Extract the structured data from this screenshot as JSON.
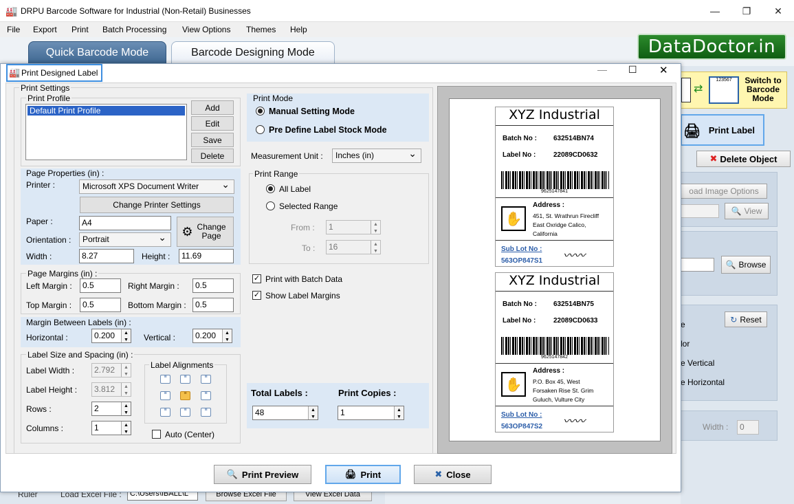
{
  "window": {
    "title": "DRPU Barcode Software for Industrial (Non-Retail) Businesses"
  },
  "menu": [
    "File",
    "Export",
    "Print",
    "Batch Processing",
    "View Options",
    "Themes",
    "Help"
  ],
  "modes": {
    "quick": "Quick Barcode Mode",
    "designing": "Barcode Designing Mode"
  },
  "brand": "DataDoctor.in",
  "right_panel": {
    "switch_label": "Switch to Barcode Mode",
    "barcode_small": "123567",
    "print_label": "Print Label",
    "delete_object": "Delete Object",
    "load_image_options": "oad Image Options",
    "view": "View",
    "browse": "Browse",
    "reset": "Reset",
    "frag_e": "e",
    "frag_lor": "lor",
    "frag_vertical": "e Vertical",
    "frag_horizontal": "e Horizontal",
    "width_label": "Width :",
    "width_value": "0"
  },
  "bottom_bg": {
    "ruler": "Ruler",
    "load_excel": "Load Excel File :",
    "excel_path": "C:\\Users\\IBALL\\L",
    "browse_excel": "Browse Excel File",
    "view_excel": "View Excel Data"
  },
  "dialog": {
    "title": "Print Designed Label",
    "print_settings": "Print Settings",
    "print_profile": {
      "label": "Print Profile",
      "items": [
        "Default Print Profile"
      ],
      "buttons": {
        "add": "Add",
        "edit": "Edit",
        "save": "Save",
        "delete": "Delete"
      }
    },
    "page_properties": {
      "label": "Page Properties (in) :",
      "printer_label": "Printer :",
      "printer": "Microsoft XPS Document Writer",
      "change_printer": "Change Printer Settings",
      "paper_label": "Paper :",
      "paper": "A4",
      "change_page": "Change Page",
      "orientation_label": "Orientation :",
      "orientation": "Portrait",
      "width_label": "Width :",
      "width": "8.27",
      "height_label": "Height :",
      "height": "11.69"
    },
    "page_margins": {
      "label": "Page Margins (in) :",
      "left_label": "Left Margin :",
      "left": "0.5",
      "right_label": "Right Margin :",
      "right": "0.5",
      "top_label": "Top Margin :",
      "top": "0.5",
      "bottom_label": "Bottom Margin :",
      "bottom": "0.5"
    },
    "margin_between": {
      "label": "Margin Between Labels (in) :",
      "horizontal_label": "Horizontal :",
      "horizontal": "0.200",
      "vertical_label": "Vertical :",
      "vertical": "0.200"
    },
    "label_size": {
      "label": "Label Size and Spacing (in) :",
      "width_label": "Label Width :",
      "width": "2.792",
      "height_label": "Label Height :",
      "height": "3.812",
      "rows_label": "Rows :",
      "rows": "2",
      "columns_label": "Columns :",
      "columns": "1",
      "alignments_label": "Label Alignments",
      "auto_center": "Auto (Center)"
    },
    "print_mode": {
      "label": "Print Mode",
      "manual": "Manual Setting Mode",
      "predefine": "Pre Define Label Stock Mode"
    },
    "measurement": {
      "label": "Measurement Unit :",
      "value": "Inches (in)"
    },
    "print_range": {
      "label": "Print Range",
      "all": "All Label",
      "selected": "Selected Range",
      "from_label": "From :",
      "from": "1",
      "to_label": "To :",
      "to": "16"
    },
    "batch_data": "Print with Batch Data",
    "show_margins": "Show Label Margins",
    "totals": {
      "total_label": "Total Labels :",
      "total": "48",
      "copies_label": "Print Copies :",
      "copies": "1"
    },
    "buttons": {
      "preview": "Print Preview",
      "print": "Print",
      "close": "Close"
    }
  },
  "preview_labels": [
    {
      "title": "XYZ Industrial",
      "batch_label": "Batch No :",
      "batch": "632514BN74",
      "lot_label": "Label No :",
      "lot": "22089CD0632",
      "barcode": "9625147841",
      "address_label": "Address :",
      "address": [
        "451, St. Wrathrun Firecliff",
        "East Oxridge Calico,",
        "California"
      ],
      "sub_lot_label": "Sub Lot No :",
      "sub_lot": "563OP847S1"
    },
    {
      "title": "XYZ Industrial",
      "batch_label": "Batch No :",
      "batch": "632514BN75",
      "lot_label": "Label No :",
      "lot": "22089CD0633",
      "barcode": "9625147842",
      "address_label": "Address :",
      "address": [
        "P.O. Box 45, West",
        "Forsaken Rise St. Grim",
        "Guluch, Vulture City"
      ],
      "sub_lot_label": "Sub Lot No :",
      "sub_lot": "563OP847S2"
    }
  ]
}
